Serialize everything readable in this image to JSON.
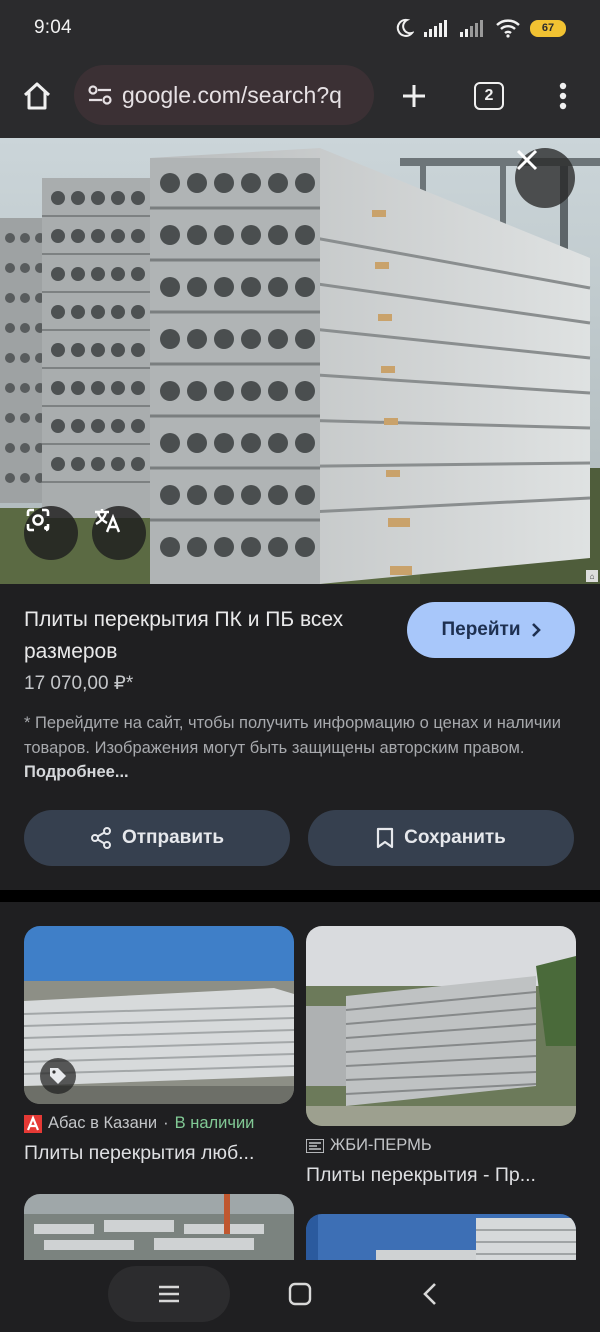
{
  "status": {
    "time": "9:04",
    "battery": "67"
  },
  "browser": {
    "url": "google.com/search?q",
    "tab_count": "2"
  },
  "product": {
    "title": "Плиты перекрытия ПК и ПБ всех размеров",
    "price": "17 070,00 ₽*",
    "go_label": "Перейти",
    "disclaimer": "* Перейдите на сайт, чтобы получить информацию о ценах и наличии товаров. Изображения могут быть защищены авторским правом.",
    "more_label": "Подробнее...",
    "share_label": "Отправить",
    "save_label": "Сохранить"
  },
  "results": [
    {
      "source": "Абас в Казани",
      "availability": "В наличии",
      "title": "Плиты перекрытия люб..."
    },
    {
      "source": "ЖБИ-ПЕРМЬ",
      "title": "Плиты перекрытия - Пр..."
    }
  ],
  "colors": {
    "accent_button": "#a8c7fa",
    "availability": "#81c995",
    "pill_button": "#36404f"
  },
  "icons": [
    "home-icon",
    "tune-icon",
    "plus-icon",
    "tabs-icon",
    "more-vert-icon",
    "close-icon",
    "lens-icon",
    "translate-icon",
    "chevron-right-icon",
    "share-icon",
    "bookmark-icon",
    "tag-icon",
    "menu-icon",
    "home-square-icon",
    "back-icon"
  ]
}
